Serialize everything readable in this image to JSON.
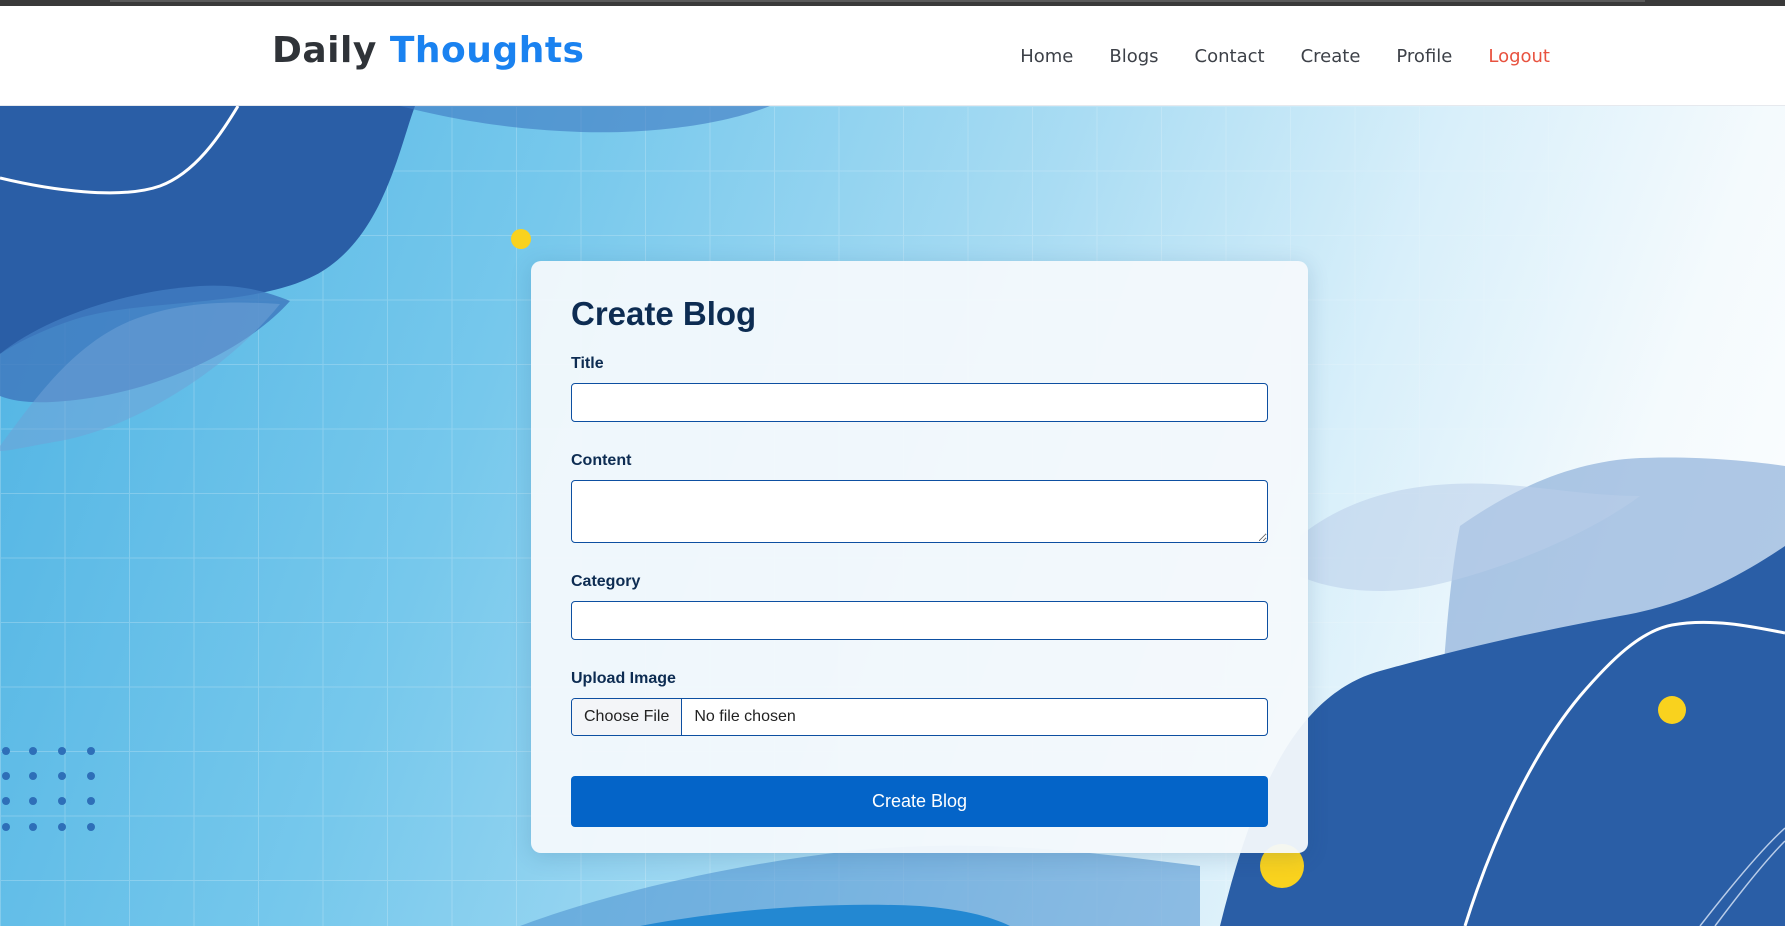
{
  "brand": {
    "name_part1": "Daily",
    "name_part2": "Thoughts"
  },
  "nav": {
    "home": "Home",
    "blogs": "Blogs",
    "contact": "Contact",
    "create": "Create",
    "profile": "Profile",
    "logout": "Logout"
  },
  "form": {
    "heading": "Create Blog",
    "title_label": "Title",
    "title_value": "",
    "content_label": "Content",
    "content_value": "",
    "category_label": "Category",
    "category_value": "",
    "upload_label": "Upload Image",
    "choose_file": "Choose File",
    "file_status": "No file chosen",
    "submit": "Create Blog"
  },
  "colors": {
    "brand_accent": "#1a82f0",
    "logout": "#e8523f",
    "primary_button": "#0464c8",
    "heading": "#0d2c52",
    "decor_yellow": "#f9d21e",
    "decor_blue": "#2a5ea6"
  }
}
